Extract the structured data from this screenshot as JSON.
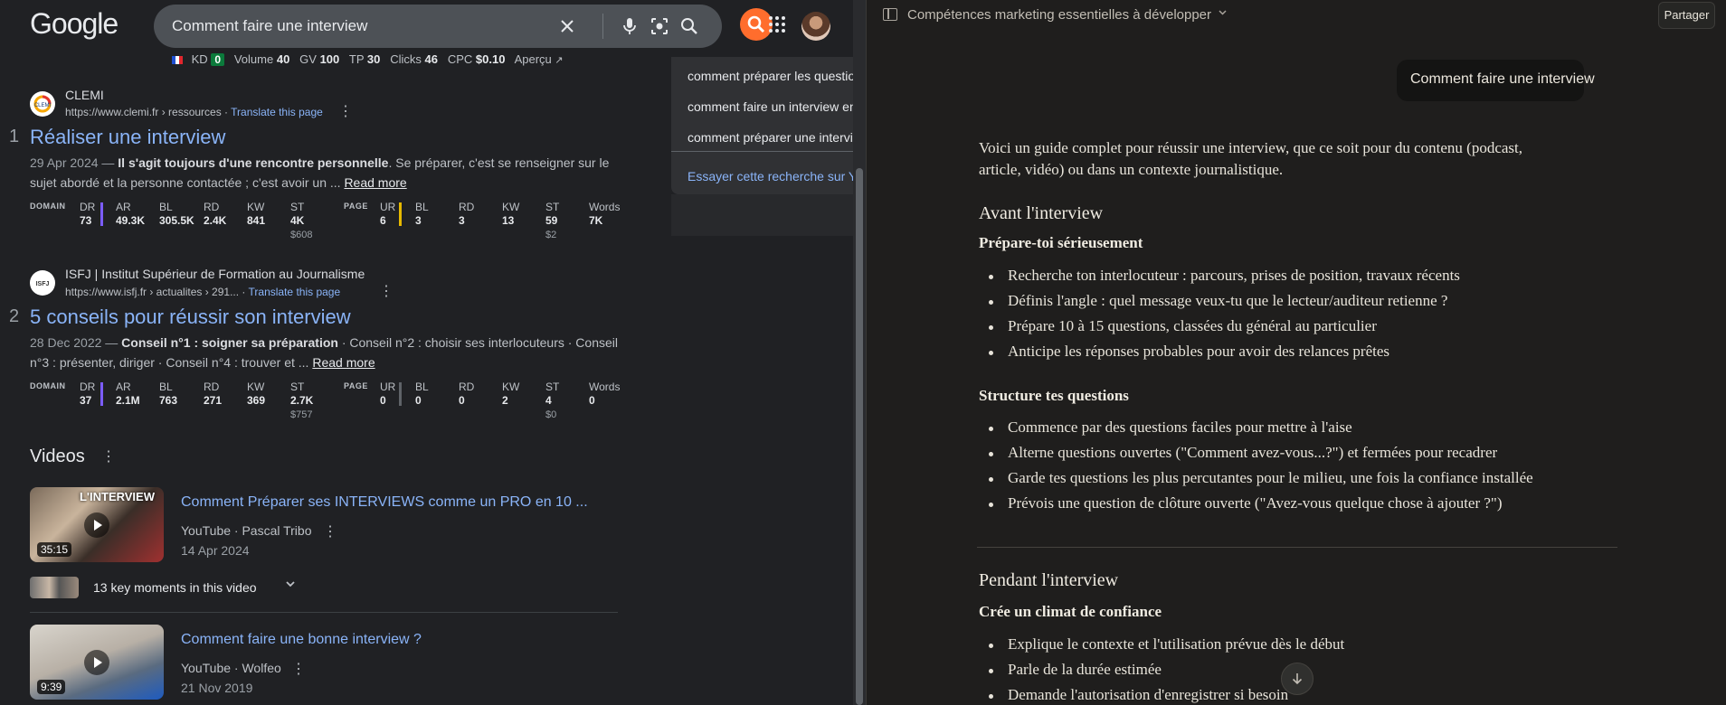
{
  "search": {
    "logo": "Google",
    "query": "Comment faire une interview"
  },
  "seo_bar": {
    "kd_label": "KD",
    "kd_value": "0",
    "volume_label": "Volume",
    "volume_value": "40",
    "gv_label": "GV",
    "gv_value": "100",
    "tp_label": "TP",
    "tp_value": "30",
    "clicks_label": "Clicks",
    "clicks_value": "46",
    "cpc_label": "CPC",
    "cpc_value": "$0.10",
    "preview_label": "Aperçu"
  },
  "suggestions": {
    "items": [
      "comment préparer les questio",
      "comment faire un interview en",
      "comment préparer une intervi"
    ],
    "try_label": "Essayer cette recherche sur Y"
  },
  "results": [
    {
      "num": "1",
      "site": "CLEMI",
      "url": "https://www.clemi.fr › ressources",
      "translate": "Translate this page",
      "title": "Réaliser une interview",
      "date": "29 Apr 2024 — ",
      "bold": "Il s'agit toujours d'une rencontre personnelle",
      "text1": ". Se préparer, c'est se renseigner sur le",
      "text2": "sujet abordé et la personne contactée ; c'est avoir un ... ",
      "read_more": "Read more",
      "domain": {
        "label": "DOMAIN",
        "dr": "73",
        "ar": "49.3K",
        "bl": "305.5K",
        "rd": "2.4K",
        "kw": "841",
        "st": "4K",
        "st_sub": "$608"
      },
      "page": {
        "label": "PAGE",
        "ur": "6",
        "bl": "3",
        "rd": "3",
        "kw": "13",
        "st": "59",
        "st_sub": "$2",
        "words": "7K"
      }
    },
    {
      "num": "2",
      "site": "ISFJ | Institut Supérieur de Formation au Journalisme",
      "url": "https://www.isfj.fr › actualites › 291...",
      "translate": "Translate this page",
      "title": "5 conseils pour réussir son interview",
      "date": "28 Dec 2022 — ",
      "bold": "Conseil n°1 : soigner sa préparation",
      "text1": " · Conseil n°2 : choisir ses interlocuteurs · Conseil",
      "text2": "n°3 : présenter, diriger · Conseil n°4 : trouver et ... ",
      "read_more": "Read more",
      "domain": {
        "label": "DOMAIN",
        "dr": "37",
        "ar": "2.1M",
        "bl": "763",
        "rd": "271",
        "kw": "369",
        "st": "2.7K",
        "st_sub": "$757"
      },
      "page": {
        "label": "PAGE",
        "ur": "0",
        "bl": "0",
        "rd": "0",
        "kw": "2",
        "st": "4",
        "st_sub": "$0",
        "words": "0"
      }
    }
  ],
  "metric_keys": {
    "dr": "DR",
    "ar": "AR",
    "bl": "BL",
    "rd": "RD",
    "kw": "KW",
    "st": "ST",
    "ur": "UR",
    "words": "Words"
  },
  "favicons": {
    "clemi": "CLEMI",
    "isfj": "ISFJ"
  },
  "videos": {
    "heading": "Videos",
    "items": [
      {
        "title": "Comment Préparer ses INTERVIEWS comme un PRO en 10 ...",
        "source": "YouTube · Pascal Tribo",
        "date": "14 Apr 2024",
        "duration": "35:15",
        "thumb_text": "L'INTERVIEW"
      },
      {
        "title": "Comment faire une bonne interview ?",
        "source": "YouTube · Wolfeo",
        "date": "21 Nov 2019",
        "duration": "9:39"
      }
    ],
    "moments_label": "13 key moments in this video"
  },
  "chat": {
    "title": "Compétences marketing essentielles à développer",
    "share_label": "Partager",
    "user_message": "Comment faire une interview",
    "intro_line1": "Voici un guide complet pour réussir une interview, que ce soit pour du contenu (podcast,",
    "intro_line2": "article, vidéo) ou dans un contexte journalistique.",
    "section1": {
      "heading": "Avant l'interview",
      "sub1": "Prépare-toi sérieusement",
      "list1": [
        "Recherche ton interlocuteur : parcours, prises de position, travaux récents",
        "Définis l'angle : quel message veux-tu que le lecteur/auditeur retienne ?",
        "Prépare 10 à 15 questions, classées du général au particulier",
        "Anticipe les réponses probables pour avoir des relances prêtes"
      ],
      "sub2": "Structure tes questions",
      "list2": [
        "Commence par des questions faciles pour mettre à l'aise",
        "Alterne questions ouvertes (\"Comment avez-vous...?\") et fermées pour recadrer",
        "Garde tes questions les plus percutantes pour le milieu, une fois la confiance installée",
        "Prévois une question de clôture ouverte (\"Avez-vous quelque chose à ajouter ?\")"
      ]
    },
    "section2": {
      "heading": "Pendant l'interview",
      "sub1": "Crée un climat de confiance",
      "list1": [
        "Explique le contexte et l'utilisation prévue dès le début",
        "Parle de la durée estimée",
        "Demande l'autorisation d'enregistrer si besoin"
      ]
    }
  },
  "colors": {
    "google_bg": "#202124",
    "link_blue": "#8ab4f8",
    "ext_orange": "#ff6d2d",
    "chat_bg": "#1f1e1d",
    "bubble_bg": "#141413"
  },
  "icons": [
    "clear-icon",
    "mic-icon",
    "lens-icon",
    "search-icon",
    "apps-icon",
    "external-link-icon",
    "kebab-icon",
    "chevron-down-icon",
    "sidebar-toggle-icon",
    "arrow-down-icon",
    "play-icon"
  ]
}
